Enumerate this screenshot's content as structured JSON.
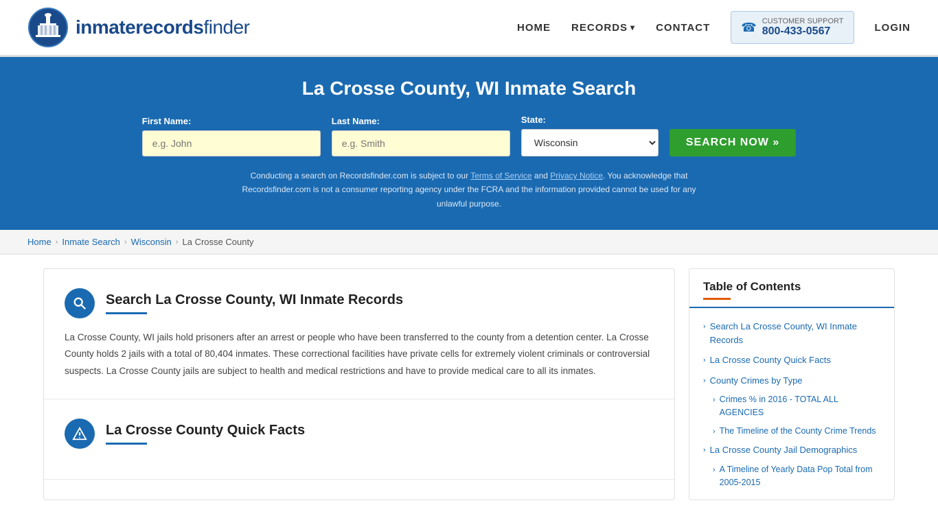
{
  "header": {
    "logo_text_light": "inmaterecords",
    "logo_text_bold": "finder",
    "nav": {
      "home": "HOME",
      "records": "RECORDS",
      "contact": "CONTACT",
      "login": "LOGIN",
      "support_label": "CUSTOMER SUPPORT",
      "support_number": "800-433-0567"
    }
  },
  "hero": {
    "title": "La Crosse County, WI Inmate Search",
    "form": {
      "first_name_label": "First Name:",
      "first_name_placeholder": "e.g. John",
      "last_name_label": "Last Name:",
      "last_name_placeholder": "e.g. Smith",
      "state_label": "State:",
      "state_value": "Wisconsin",
      "search_button": "SEARCH NOW »"
    },
    "disclaimer": "Conducting a search on Recordsfinder.com is subject to our Terms of Service and Privacy Notice. You acknowledge that Recordsfinder.com is not a consumer reporting agency under the FCRA and the information provided cannot be used for any unlawful purpose."
  },
  "breadcrumb": {
    "home": "Home",
    "inmate_search": "Inmate Search",
    "state": "Wisconsin",
    "county": "La Crosse County"
  },
  "main": {
    "sections": [
      {
        "id": "inmate-records",
        "icon": "search",
        "title": "Search La Crosse County, WI Inmate Records",
        "body": "La Crosse County, WI jails hold prisoners after an arrest or people who have been transferred to the county from a detention center. La Crosse County holds 2 jails with a total of 80,404 inmates. These correctional facilities have private cells for extremely violent criminals or controversial suspects. La Crosse County jails are subject to health and medical restrictions and have to provide medical care to all its inmates."
      },
      {
        "id": "quick-facts",
        "icon": "info",
        "title": "La Crosse County Quick Facts",
        "body": ""
      }
    ]
  },
  "toc": {
    "title": "Table of Contents",
    "items": [
      {
        "label": "Search La Crosse County, WI Inmate Records",
        "sub": false
      },
      {
        "label": "La Crosse County Quick Facts",
        "sub": false
      },
      {
        "label": "County Crimes by Type",
        "sub": false
      },
      {
        "label": "Crimes % in 2016 - TOTAL ALL AGENCIES",
        "sub": true
      },
      {
        "label": "The Timeline of the County Crime Trends",
        "sub": true
      },
      {
        "label": "La Crosse County Jail Demographics",
        "sub": false
      },
      {
        "label": "A Timeline of Yearly Data Pop Total from 2005-2015",
        "sub": true
      }
    ]
  }
}
